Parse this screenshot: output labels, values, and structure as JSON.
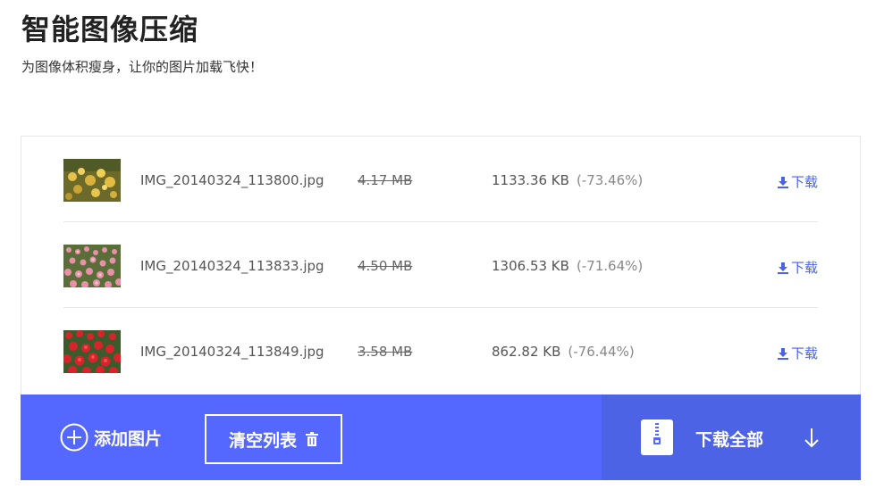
{
  "page": {
    "title": "智能图像压缩",
    "subtitle": "为图像体积瘦身，让你的图片加载飞快！"
  },
  "files": [
    {
      "name": "IMG_20140324_113800.jpg",
      "original_size": "4.17 MB",
      "compressed_size": "1133.36 KB",
      "ratio": "(-73.46%)",
      "download_label": "下载",
      "thumb": "yellow-orchids"
    },
    {
      "name": "IMG_20140324_113833.jpg",
      "original_size": "4.50 MB",
      "compressed_size": "1306.53 KB",
      "ratio": "(-71.64%)",
      "download_label": "下载",
      "thumb": "pink-tulips"
    },
    {
      "name": "IMG_20140324_113849.jpg",
      "original_size": "3.58 MB",
      "compressed_size": "862.82 KB",
      "ratio": "(-76.44%)",
      "download_label": "下载",
      "thumb": "red-tulips"
    }
  ],
  "toolbar": {
    "add_label": "添加图片",
    "clear_label": "清空列表",
    "download_all_label": "下载全部"
  },
  "colors": {
    "accent": "#5468ff",
    "accent_dark": "#4d63e6",
    "link": "#4a63e6"
  },
  "icons": {
    "add": "plus-circle-icon",
    "clear": "trash-icon",
    "zip": "zip-file-icon",
    "download": "download-icon",
    "arrow": "arrow-down-icon"
  }
}
